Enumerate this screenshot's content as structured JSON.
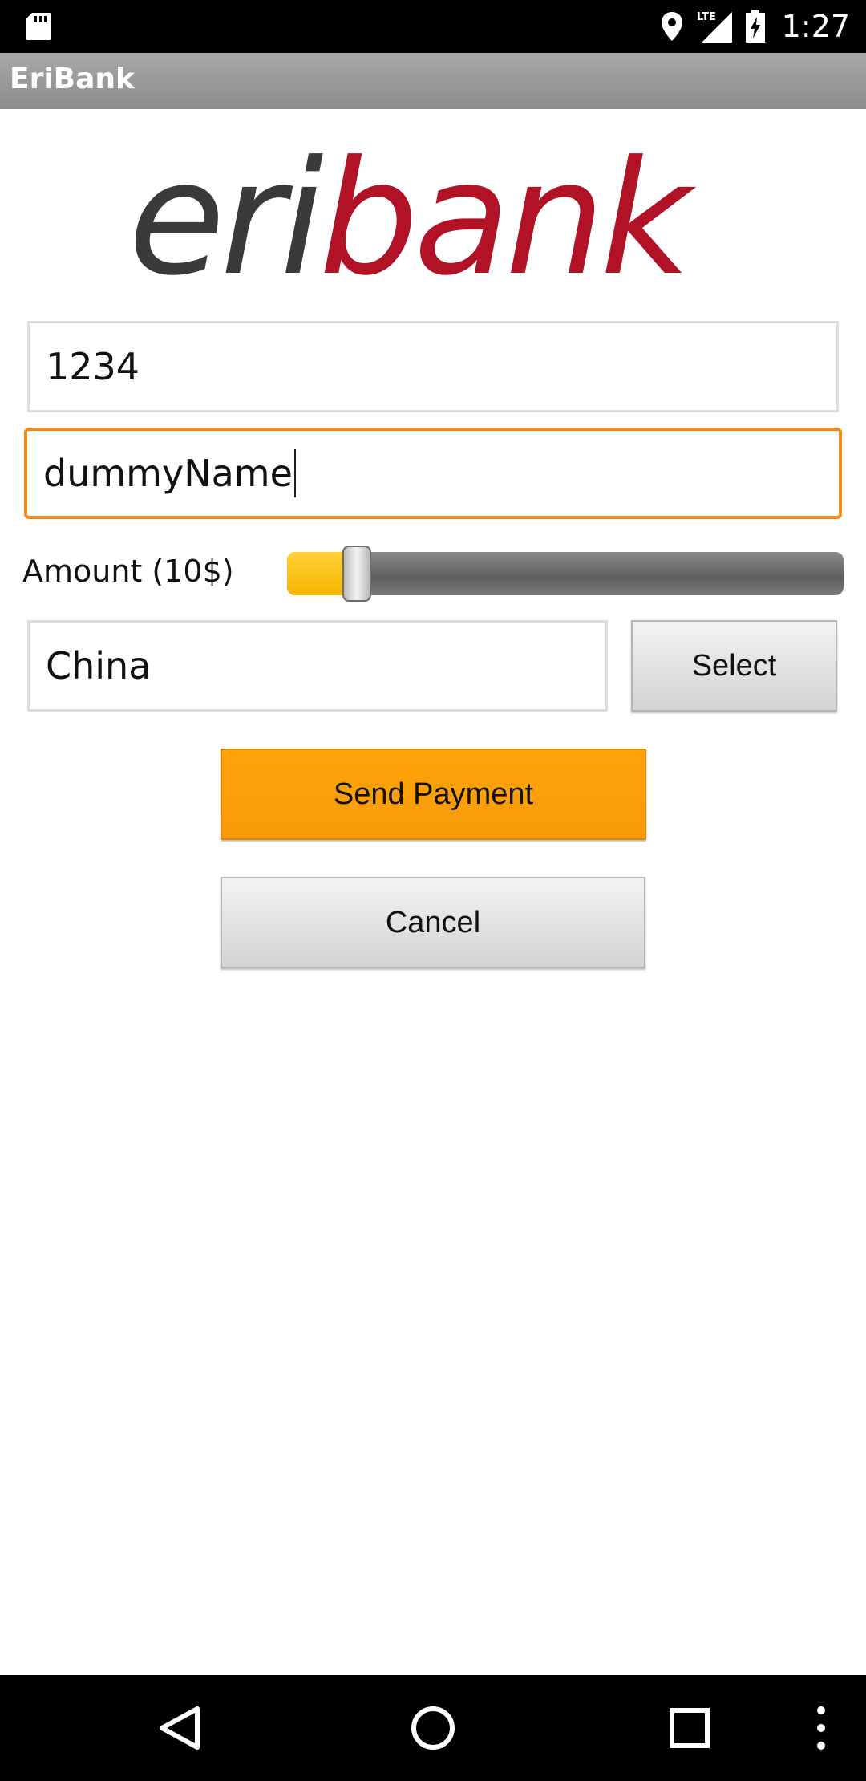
{
  "status_bar": {
    "time": "1:27",
    "icons": [
      "sd-card-icon",
      "location-icon",
      "lte-signal-icon",
      "battery-charging-icon"
    ],
    "network_label": "LTE"
  },
  "app": {
    "title": "EriBank"
  },
  "logo": {
    "text_dark": "eri",
    "text_accent": "bank",
    "color_dark": "#3a3a3a",
    "color_accent": "#b11226"
  },
  "form": {
    "account_value": "1234",
    "name_value": "dummyName",
    "amount_label": "Amount (10$)",
    "amount_slider_fraction": 0.125,
    "country_value": "China",
    "select_label": "Select",
    "send_label": "Send Payment",
    "cancel_label": "Cancel"
  },
  "colors": {
    "focus_border": "#f28a1c",
    "send_button": "#ffa30a",
    "slider_fill": "#f5b400"
  },
  "nav_bar": {
    "icons": [
      "back-icon",
      "home-icon",
      "recents-icon",
      "overflow-menu-icon"
    ]
  }
}
